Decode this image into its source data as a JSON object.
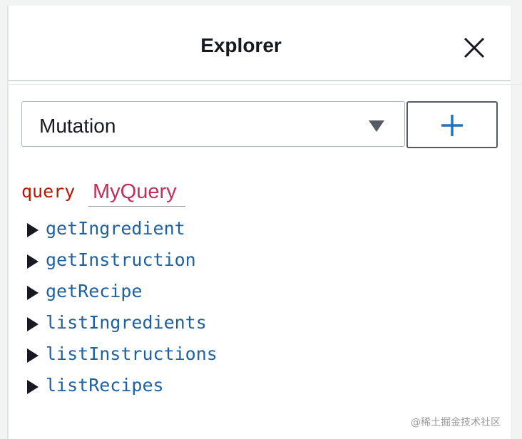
{
  "explorer": {
    "title": "Explorer",
    "close_icon": "close-icon"
  },
  "operation_select": {
    "value": "Mutation",
    "caret_icon": "caret-down-icon"
  },
  "add_button": {
    "icon": "plus-icon"
  },
  "query": {
    "keyword": "query",
    "name": "MyQuery"
  },
  "fields": [
    {
      "name": "getIngredient",
      "icon": "caret-right-icon"
    },
    {
      "name": "getInstruction",
      "icon": "caret-right-icon"
    },
    {
      "name": "getRecipe",
      "icon": "caret-right-icon"
    },
    {
      "name": "listIngredients",
      "icon": "caret-right-icon"
    },
    {
      "name": "listInstructions",
      "icon": "caret-right-icon"
    },
    {
      "name": "listRecipes",
      "icon": "caret-right-icon"
    }
  ],
  "watermark": "@稀土掘金技术社区",
  "colors": {
    "keyword": "#b11a04",
    "query_name": "#c52f5a",
    "field_name": "#1f61a0",
    "add_icon": "#1f74c6"
  }
}
